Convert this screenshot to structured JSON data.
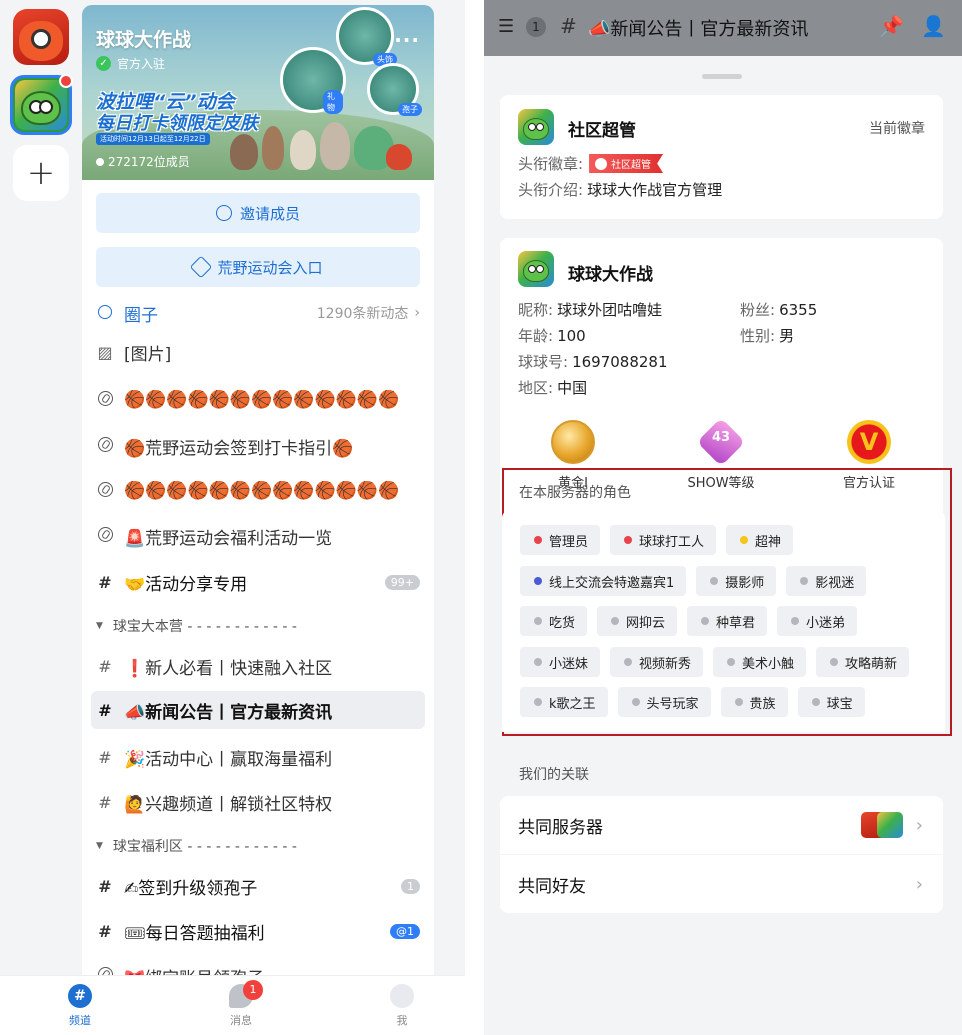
{
  "left": {
    "server_rail": {
      "add_label": "+"
    },
    "banner": {
      "server_name": "球球大作战",
      "official_label": "官方入驻",
      "more_label": "...",
      "promo_line1": "波拉哩“云”动会",
      "promo_line2": "每日打卡领限定皮肤",
      "promo_line3": "活动时间12月13日起至12月22日",
      "member_count": "272172位成员",
      "bubble_labels": [
        "头饰",
        "礼物",
        "孢子"
      ]
    },
    "invite_button": "邀请成员",
    "wild_button": "荒野运动会入口",
    "circle": {
      "name": "圈子",
      "meta": "1290条新动态"
    },
    "channels": [
      {
        "name": "[图片]"
      },
      {
        "name": "🏀🏀🏀🏀🏀🏀🏀🏀🏀🏀🏀🏀🏀"
      },
      {
        "name": "🏀荒野运动会签到打卡指引🏀"
      },
      {
        "name": "🏀🏀🏀🏀🏀🏀🏀🏀🏀🏀🏀🏀🏀"
      },
      {
        "name": "🚨荒野运动会福利活动一览"
      },
      {
        "name": "🤝活动分享专用",
        "badge": "99+"
      }
    ],
    "category1": {
      "name": "球宝大本营 - - - - - - - - - - - -"
    },
    "category1_channels": [
      {
        "name": "❗新人必看丨快速融入社区"
      },
      {
        "name": "📣新闻公告丨官方最新资讯"
      },
      {
        "name": "🎉活动中心丨赢取海量福利"
      },
      {
        "name": "🙋兴趣频道丨解锁社区特权"
      }
    ],
    "category2": {
      "name": "球宝福利区 - - - - - - - - - - - -"
    },
    "category2_channels": [
      {
        "name": "✍签到升级领孢子",
        "badge": "1"
      },
      {
        "name": "🎟每日答题抽福利",
        "badge": "@1"
      },
      {
        "name": "🎀绑定账号领孢子"
      }
    ],
    "bottom_nav": {
      "channel": "频道",
      "message": "消息",
      "message_badge": "1",
      "me": "我"
    }
  },
  "right": {
    "header": {
      "count": "1",
      "hash": "#",
      "title": "📣新闻公告丨官方最新资讯"
    },
    "role_card": {
      "name": "社区超管",
      "current_label": "当前徽章",
      "badge_label": "头衔徽章:",
      "badge_tag": "社区超管",
      "desc_label": "头衔介绍:",
      "desc_value": "球球大作战官方管理"
    },
    "profile": {
      "name": "球球大作战",
      "nick_label": "昵称:",
      "nick": "球球外团咕噜娃",
      "fans_label": "粉丝:",
      "fans": "6355",
      "age_label": "年龄:",
      "age": "100",
      "gender_label": "性别:",
      "gender": "男",
      "qid_label": "球球号:",
      "qid": "1697088281",
      "region_label": "地区:",
      "region": "中国",
      "medals": [
        {
          "label": "黄金I"
        },
        {
          "label": "SHOW等级",
          "value": "43"
        },
        {
          "label": "官方认证",
          "glyph": "V"
        }
      ]
    },
    "roles": {
      "title": "在本服务器的角色",
      "items": [
        {
          "name": "管理员",
          "color": "#e8424a"
        },
        {
          "name": "球球打工人",
          "color": "#e8424a"
        },
        {
          "name": "超神",
          "color": "#f5c518"
        },
        {
          "name": "线上交流会特邀嘉宾1",
          "color": "#4a5bd4"
        },
        {
          "name": "摄影师",
          "color": "#b3b6bd"
        },
        {
          "name": "影视迷",
          "color": "#b3b6bd"
        },
        {
          "name": "吃货",
          "color": "#b3b6bd"
        },
        {
          "name": "网抑云",
          "color": "#b3b6bd"
        },
        {
          "name": "种草君",
          "color": "#b3b6bd"
        },
        {
          "name": "小迷弟",
          "color": "#b3b6bd"
        },
        {
          "name": "小迷妹",
          "color": "#b3b6bd"
        },
        {
          "name": "视频新秀",
          "color": "#b3b6bd"
        },
        {
          "name": "美术小触",
          "color": "#b3b6bd"
        },
        {
          "name": "攻略萌新",
          "color": "#b3b6bd"
        },
        {
          "name": "k歌之王",
          "color": "#b3b6bd"
        },
        {
          "name": "头号玩家",
          "color": "#b3b6bd"
        },
        {
          "name": "贵族",
          "color": "#b3b6bd"
        },
        {
          "name": "球宝",
          "color": "#b3b6bd"
        }
      ]
    },
    "relations": {
      "title": "我们的关联",
      "common_servers": "共同服务器",
      "common_friends": "共同好友"
    }
  }
}
